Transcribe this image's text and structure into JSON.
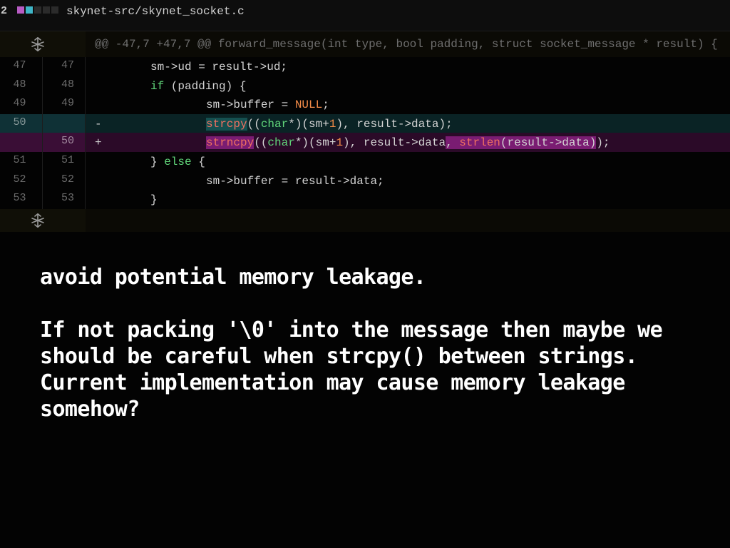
{
  "file": {
    "changes_count": "2",
    "path": "skynet-src/skynet_socket.c",
    "diffstat_colors": [
      "#b85cc4",
      "#3fb6c8",
      "#2b2b2b",
      "#2b2b2b",
      "#2b2b2b"
    ]
  },
  "diff": {
    "hunk_header": "@@ -47,7 +47,7 @@ forward_message(int type, bool padding, struct socket_message * result) {",
    "lines": [
      {
        "type": "context",
        "old": "47",
        "new": "47",
        "marker": "",
        "code": "sm->ud = result->ud;"
      },
      {
        "type": "context",
        "old": "48",
        "new": "48",
        "marker": "",
        "code": "if (padding) {"
      },
      {
        "type": "context",
        "old": "49",
        "new": "49",
        "marker": "",
        "code": "\tsm->buffer = NULL;"
      },
      {
        "type": "del",
        "old": "50",
        "new": "",
        "marker": "-",
        "code": "\tstrcpy((char*)(sm+1), result->data);"
      },
      {
        "type": "add",
        "old": "",
        "new": "50",
        "marker": "+",
        "code": "\tstrncpy((char*)(sm+1), result->data, strlen(result->data));"
      },
      {
        "type": "context",
        "old": "51",
        "new": "51",
        "marker": "",
        "code": "} else {"
      },
      {
        "type": "context",
        "old": "52",
        "new": "52",
        "marker": "",
        "code": "\tsm->buffer = result->data;"
      },
      {
        "type": "context",
        "old": "53",
        "new": "53",
        "marker": "",
        "code": "}"
      }
    ]
  },
  "colors": {
    "deletion_bg": "#0a2325",
    "addition_bg": "#2b0a28",
    "keyword": "#61d67a",
    "literal": "#f28b48"
  },
  "icons": {
    "expand_up": "expand-up-icon",
    "expand_down": "expand-down-icon"
  },
  "message": {
    "title": "avoid potential memory leakage.",
    "body": "If not packing '\\0' into the message then maybe we should be careful when strcpy() between strings. Current implementation may cause memory leakage somehow?"
  }
}
